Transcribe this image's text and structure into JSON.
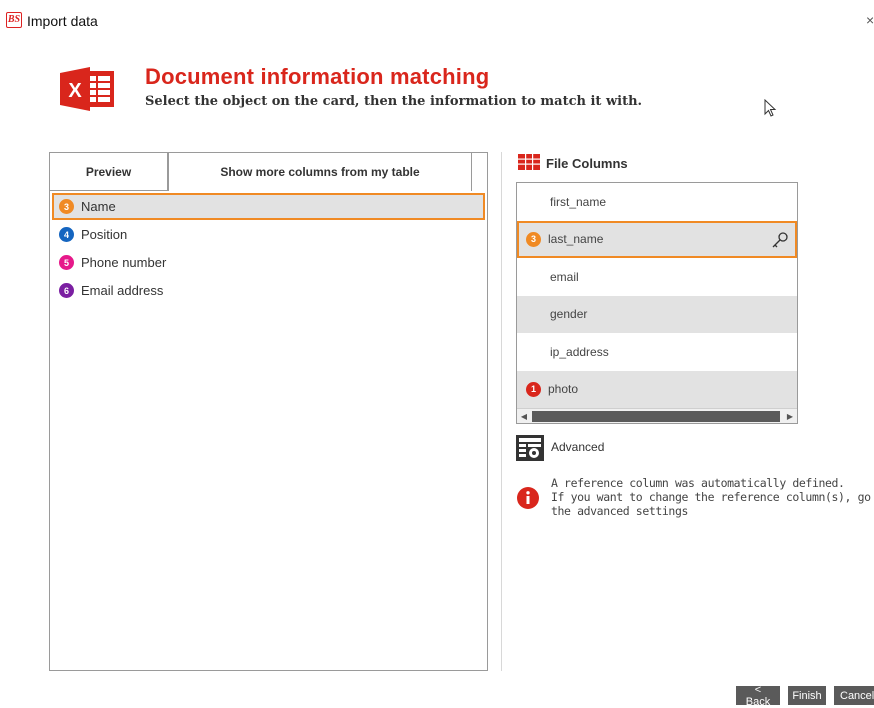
{
  "window": {
    "logo_text": "BS",
    "title": "Import data",
    "close_glyph": "×"
  },
  "header": {
    "icon": "excel-icon",
    "title": "Document information matching",
    "subtitle": "Select the object on the card, then the information to match it with."
  },
  "tabs": {
    "preview": "Preview",
    "more_columns": "Show more columns from my table"
  },
  "fields": [
    {
      "number": "3",
      "label": "Name",
      "color": "#f08a24",
      "selected": true
    },
    {
      "number": "4",
      "label": "Position",
      "color": "#1565c0",
      "selected": false
    },
    {
      "number": "5",
      "label": "Phone number",
      "color": "#e6198a",
      "selected": false
    },
    {
      "number": "6",
      "label": "Email address",
      "color": "#7b1fa2",
      "selected": false
    }
  ],
  "file_columns": {
    "title": "File Columns",
    "rows": [
      {
        "label": "first_name"
      },
      {
        "label": "last_name",
        "badge": "3",
        "badge_color": "#f08a24",
        "selected": true,
        "key": true
      },
      {
        "label": "email"
      },
      {
        "label": "gender"
      },
      {
        "label": "ip_address"
      },
      {
        "label": "photo",
        "badge": "1",
        "badge_color": "#d9261c"
      }
    ]
  },
  "advanced": {
    "label": "Advanced"
  },
  "info": {
    "lines": [
      "A reference column was automatically defined.",
      "If you want to change the reference column(s), go to",
      "the advanced settings"
    ]
  },
  "buttons": {
    "back": "< Back",
    "finish": "Finish",
    "cancel": "Cancel"
  },
  "colors": {
    "accent_red": "#d9261c",
    "selection_orange": "#f08a24",
    "button_gray": "#5a5a5a"
  }
}
